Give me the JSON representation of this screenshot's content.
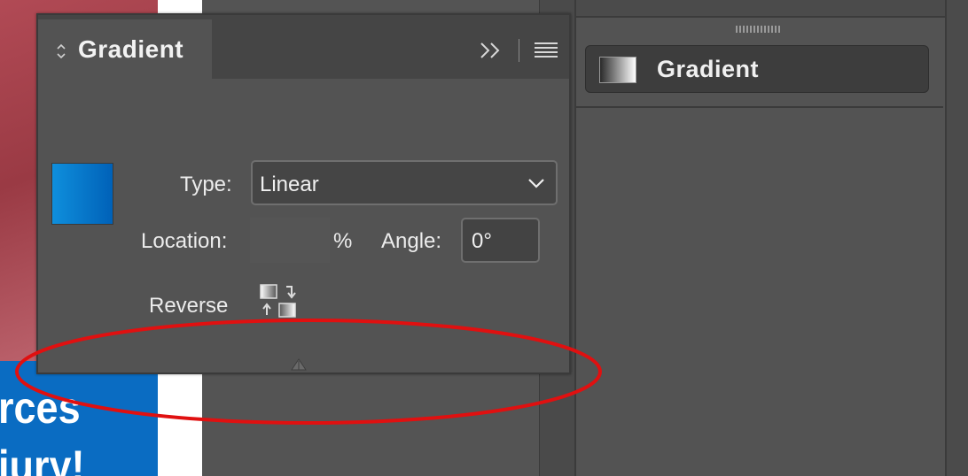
{
  "document": {
    "headline_line1": "rces",
    "headline_line2": "jury!"
  },
  "panel": {
    "tab_title": "Gradient",
    "collapse_icon": "double-chevron-right-icon",
    "menu_icon": "hamburger-menu-icon",
    "type": {
      "label": "Type:",
      "value": "Linear",
      "dropdown_icon": "chevron-down-icon"
    },
    "location": {
      "label": "Location:",
      "value": "",
      "unit": "%"
    },
    "angle": {
      "label": "Angle:",
      "value": "0°"
    },
    "reverse": {
      "label": "Reverse",
      "icon": "reverse-gradient-icon"
    },
    "swatch_colors": [
      "#0f8fdc",
      "#0061b8"
    ]
  },
  "dock": {
    "button_label": "Gradient",
    "button_icon": "gradient-icon"
  },
  "annotation": {
    "shape": "ellipse",
    "color": "#e01010"
  }
}
